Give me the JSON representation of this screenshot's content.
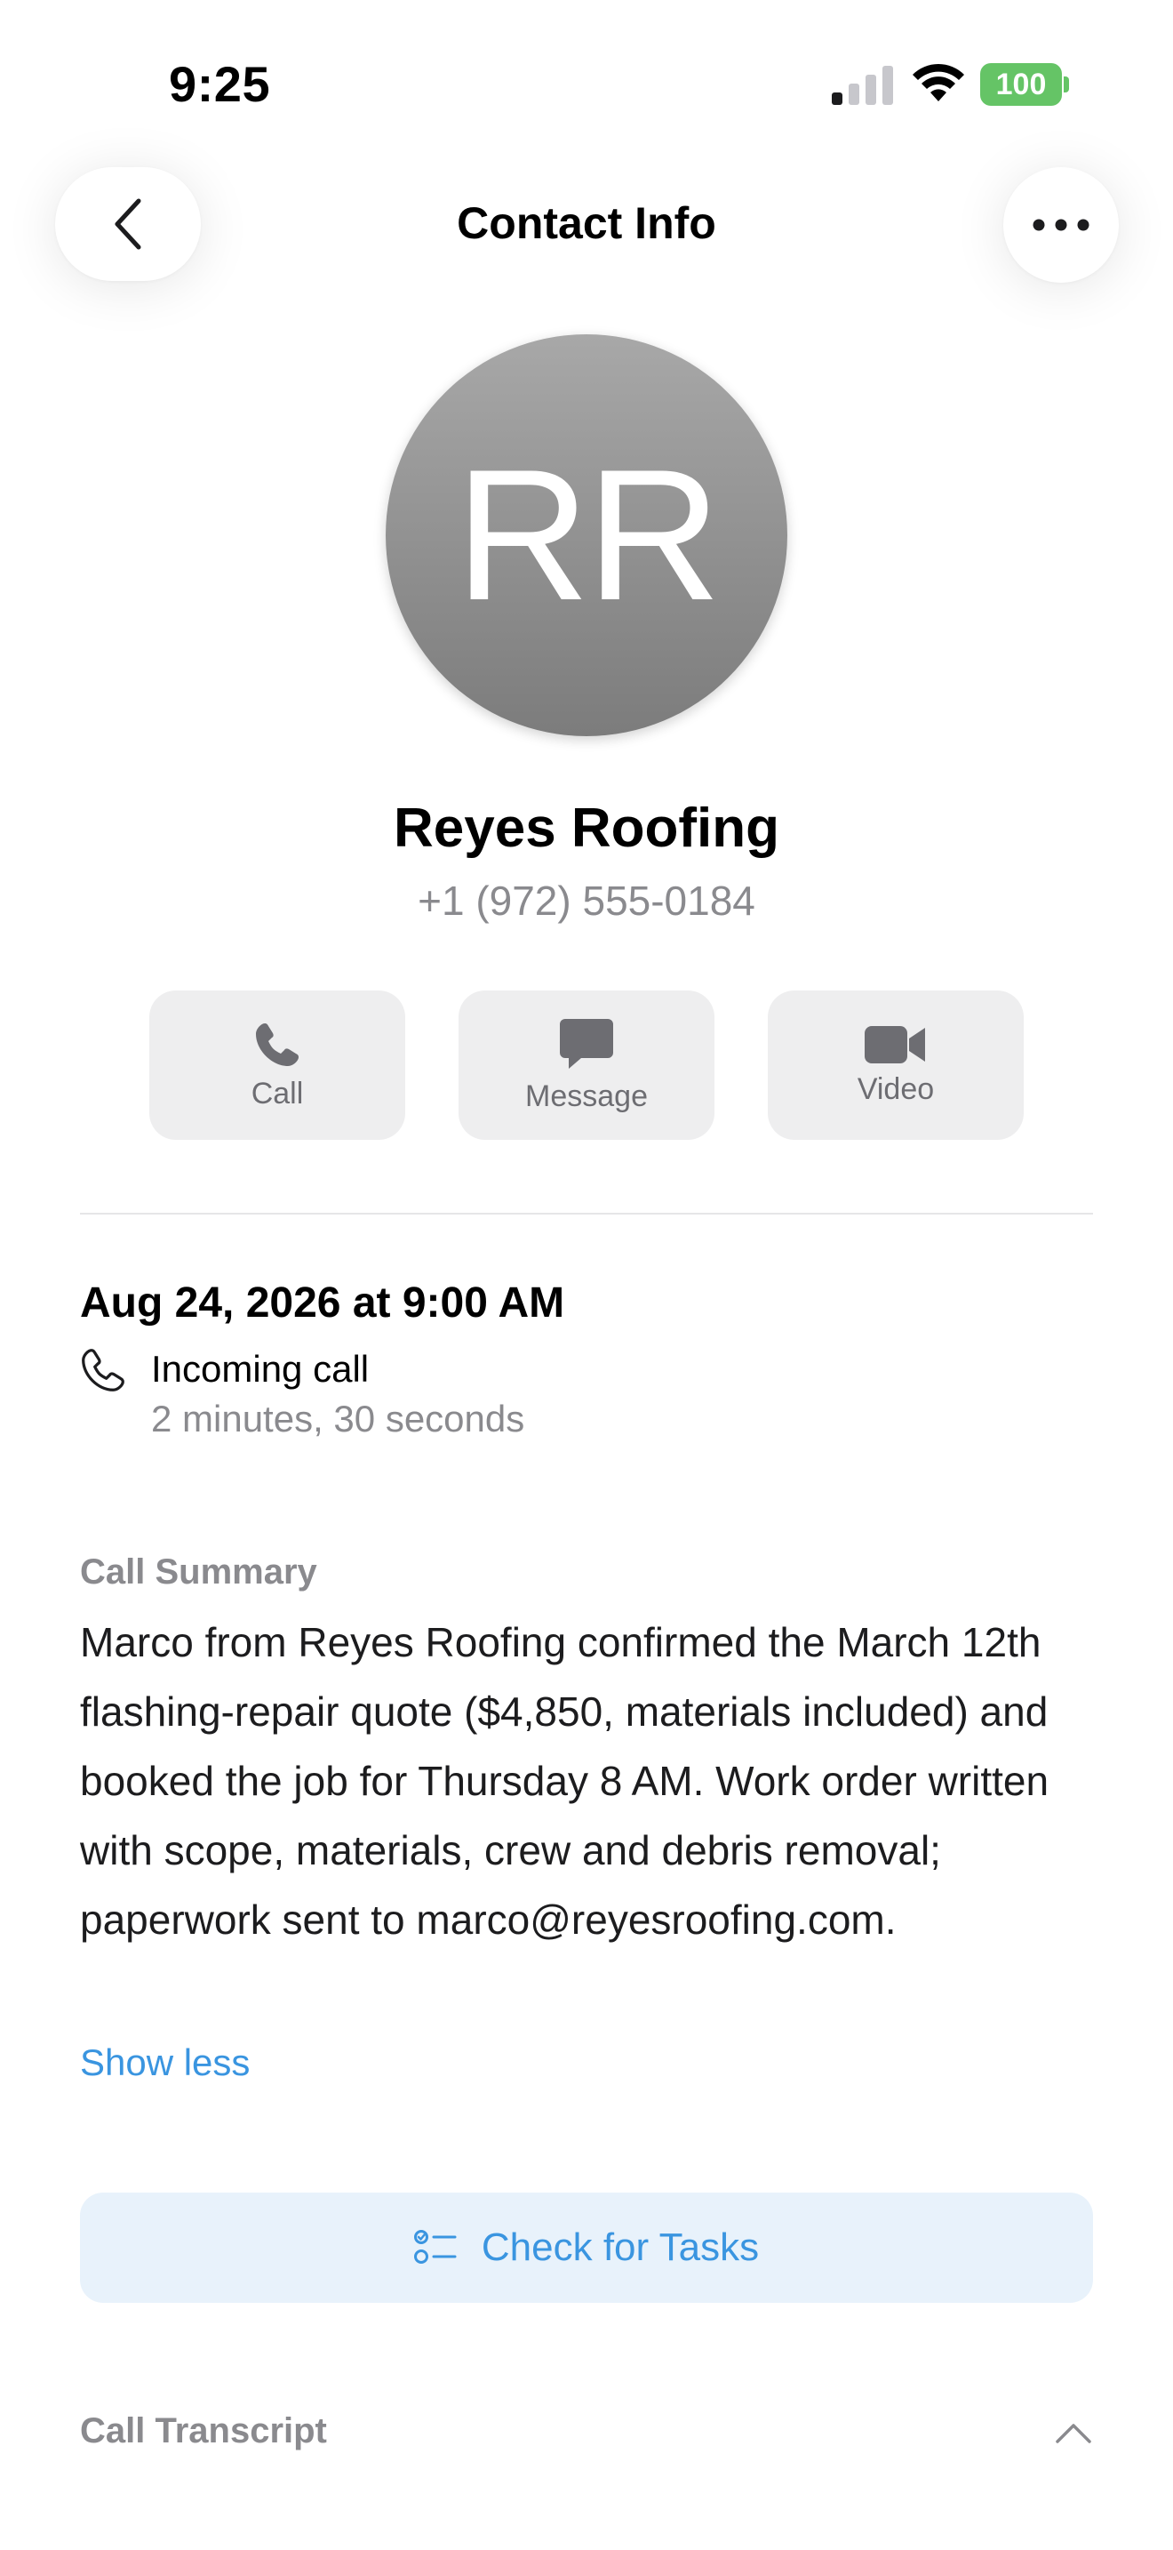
{
  "status_bar": {
    "time": "9:25",
    "battery": "100"
  },
  "nav": {
    "title": "Contact Info"
  },
  "contact": {
    "initials": "RR",
    "name": "Reyes Roofing",
    "phone": "+1 (972) 555-0184"
  },
  "actions": [
    {
      "label": "Call",
      "icon": "phone-icon"
    },
    {
      "label": "Message",
      "icon": "message-bubble-icon"
    },
    {
      "label": "Video",
      "icon": "video-camera-icon"
    }
  ],
  "call": {
    "date": "Aug 24, 2026 at 9:00 AM",
    "type": "Incoming call",
    "duration": "2 minutes, 30 seconds"
  },
  "summary": {
    "label": "Call Summary",
    "text": "Marco from Reyes Roofing confirmed the March 12th flashing-repair quote ($4,850, materials included) and booked the job for Thursday 8 AM. Work order written with scope, materials, crew and debris removal; paperwork sent to marco@reyesroofing.com.",
    "toggle": "Show less"
  },
  "tasks_button": {
    "label": "Check for Tasks",
    "icon": "checklist-icon"
  },
  "transcript": {
    "label": "Call Transcript",
    "icon": "chevron-up-icon"
  },
  "colors": {
    "accent": "#3a95e0",
    "battery": "#65c466",
    "secondary_text": "#8a8a8e"
  }
}
